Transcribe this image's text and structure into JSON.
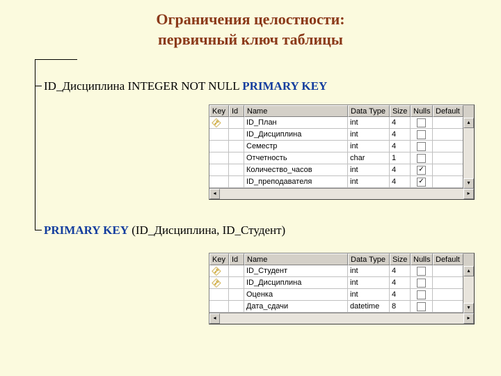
{
  "title_line1": "Ограничения целостности:",
  "title_line2": "первичный ключ таблицы",
  "sql1": {
    "col": "ID_Дисциплина",
    "rest": " INTEGER NOT NULL ",
    "pk": "PRIMARY KEY"
  },
  "sql2": {
    "pk": "PRIMARY KEY",
    "rest": " (ID_Дисциплина, ID_Студент)"
  },
  "headers": {
    "key": "Key",
    "id": "Id",
    "name": "Name",
    "type": "Data Type",
    "size": "Size",
    "nulls": "Nulls",
    "def": "Default"
  },
  "table1": {
    "rows": [
      {
        "key": true,
        "name": "ID_План",
        "type": "int",
        "size": "4",
        "nulls": false
      },
      {
        "key": false,
        "name": "ID_Дисциплина",
        "type": "int",
        "size": "4",
        "nulls": false
      },
      {
        "key": false,
        "name": "Семестр",
        "type": "int",
        "size": "4",
        "nulls": false
      },
      {
        "key": false,
        "name": "Отчетность",
        "type": "char",
        "size": "1",
        "nulls": false
      },
      {
        "key": false,
        "name": "Количество_часов",
        "type": "int",
        "size": "4",
        "nulls": true
      },
      {
        "key": false,
        "name": "ID_преподавателя",
        "type": "int",
        "size": "4",
        "nulls": true
      }
    ]
  },
  "table2": {
    "rows": [
      {
        "key": true,
        "name": "ID_Студент",
        "type": "int",
        "size": "4",
        "nulls": false
      },
      {
        "key": true,
        "name": "ID_Дисциплина",
        "type": "int",
        "size": "4",
        "nulls": false
      },
      {
        "key": false,
        "name": "Оценка",
        "type": "int",
        "size": "4",
        "nulls": false
      },
      {
        "key": false,
        "name": "Дата_сдачи",
        "type": "datetime",
        "size": "8",
        "nulls": false
      }
    ]
  }
}
